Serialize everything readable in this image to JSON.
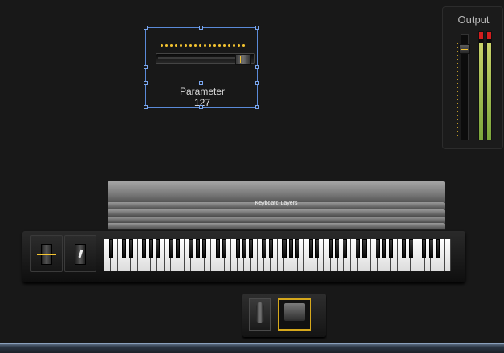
{
  "selected_control": {
    "label": "Parameter",
    "value": "127",
    "level_fraction": 1.0
  },
  "output_panel": {
    "title": "Output",
    "volume_level_fraction": 0.9,
    "meter_left_level_fraction": 0.95,
    "meter_right_level_fraction": 0.95
  },
  "keyboard_layers": {
    "title": "Keyboard Layers"
  },
  "colors": {
    "accent": "#f4c430",
    "selection": "#5a8ad8",
    "meter_peak": "#d21e1e",
    "meter_level": "#9bbd4a"
  }
}
